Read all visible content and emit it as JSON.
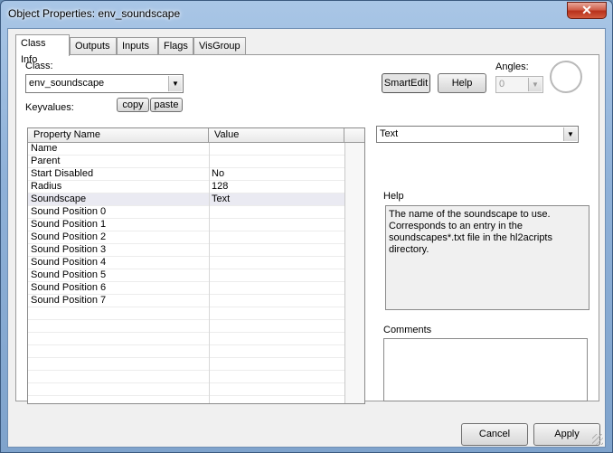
{
  "window": {
    "title": "Object Properties: env_soundscape",
    "close_label": "✕"
  },
  "tabs": [
    {
      "label": "Class Info",
      "active": true
    },
    {
      "label": "Outputs",
      "active": false
    },
    {
      "label": "Inputs",
      "active": false
    },
    {
      "label": "Flags",
      "active": false
    },
    {
      "label": "VisGroup",
      "active": false
    }
  ],
  "class_info": {
    "class_label": "Class:",
    "class_value": "env_soundscape",
    "keyvalues_label": "Keyvalues:",
    "copy_label": "copy",
    "paste_label": "paste",
    "smartedit_label": "SmartEdit",
    "help_button_label": "Help",
    "angles_label": "Angles:",
    "angles_value": "0"
  },
  "grid": {
    "headers": [
      "Property Name",
      "Value"
    ],
    "rows": [
      {
        "name": "Name",
        "value": ""
      },
      {
        "name": "Parent",
        "value": ""
      },
      {
        "name": "Start Disabled",
        "value": "No"
      },
      {
        "name": "Radius",
        "value": "128"
      },
      {
        "name": "Soundscape",
        "value": "Text",
        "selected": true
      },
      {
        "name": "Sound Position 0",
        "value": ""
      },
      {
        "name": "Sound Position 1",
        "value": ""
      },
      {
        "name": "Sound Position 2",
        "value": ""
      },
      {
        "name": "Sound Position 3",
        "value": ""
      },
      {
        "name": "Sound Position 4",
        "value": ""
      },
      {
        "name": "Sound Position 5",
        "value": ""
      },
      {
        "name": "Sound Position 6",
        "value": ""
      },
      {
        "name": "Sound Position 7",
        "value": ""
      }
    ]
  },
  "value_editor": {
    "type_value": "Text"
  },
  "help": {
    "label": "Help",
    "text": "The name of the soundscape to use. Corresponds to an entry in the soundscapes*.txt file in the hl2acripts directory."
  },
  "comments": {
    "label": "Comments",
    "value": ""
  },
  "footer": {
    "cancel_label": "Cancel",
    "apply_label": "Apply"
  },
  "icons": {
    "dropdown": "chevron-down-icon",
    "close": "close-icon",
    "dial": "angle-dial-icon"
  }
}
